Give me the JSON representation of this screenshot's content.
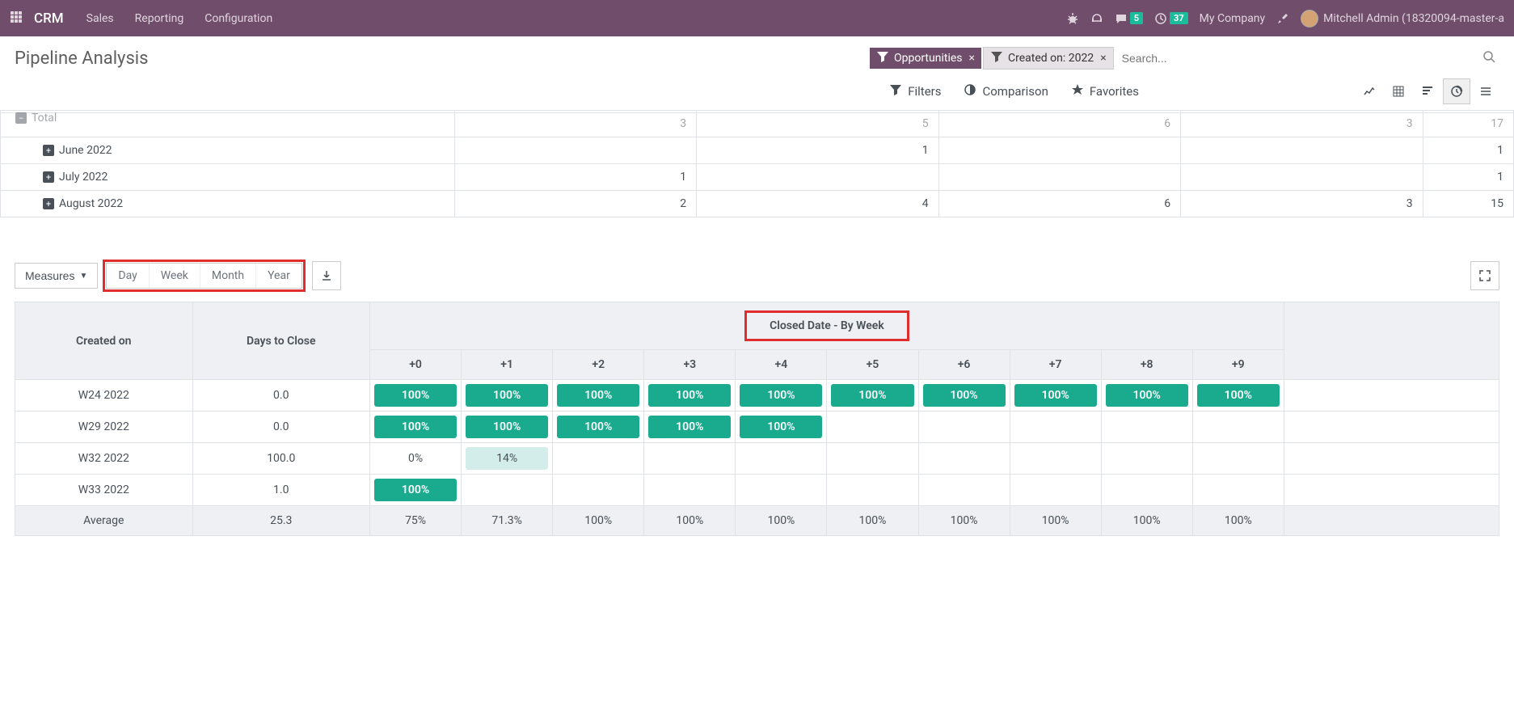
{
  "navbar": {
    "brand": "CRM",
    "links": [
      "Sales",
      "Reporting",
      "Configuration"
    ],
    "msg_badge": "5",
    "clock_badge": "37",
    "company": "My Company",
    "user": "Mitchell Admin (18320094-master-a"
  },
  "page": {
    "title": "Pipeline Analysis",
    "filter1": "Opportunities",
    "filter2": "Created on: 2022",
    "search_placeholder": "Search..."
  },
  "toolbar": {
    "filters": "Filters",
    "comparison": "Comparison",
    "favorites": "Favorites"
  },
  "pivot": {
    "rows": [
      {
        "label": "Total",
        "minus": true,
        "cells": [
          "3",
          "5",
          "6",
          "3",
          "17"
        ]
      },
      {
        "label": "June 2022",
        "minus": false,
        "cells": [
          "",
          "1",
          "",
          "",
          "1"
        ]
      },
      {
        "label": "July 2022",
        "minus": false,
        "cells": [
          "1",
          "",
          "",
          "",
          "1"
        ]
      },
      {
        "label": "August 2022",
        "minus": false,
        "cells": [
          "2",
          "4",
          "6",
          "3",
          "15"
        ]
      }
    ]
  },
  "cohort_controls": {
    "measures": "Measures",
    "segs": [
      "Day",
      "Week",
      "Month",
      "Year"
    ]
  },
  "cohort": {
    "header1": "Created on",
    "header2": "Days to Close",
    "super_header": "Closed Date - By Week",
    "cols": [
      "+0",
      "+1",
      "+2",
      "+3",
      "+4",
      "+5",
      "+6",
      "+7",
      "+8",
      "+9"
    ],
    "rows": [
      {
        "label": "W24 2022",
        "days": "0.0",
        "pct": [
          "100%",
          "100%",
          "100%",
          "100%",
          "100%",
          "100%",
          "100%",
          "100%",
          "100%",
          "100%"
        ]
      },
      {
        "label": "W29 2022",
        "days": "0.0",
        "pct": [
          "100%",
          "100%",
          "100%",
          "100%",
          "100%",
          "",
          "",
          "",
          "",
          ""
        ]
      },
      {
        "label": "W32 2022",
        "days": "100.0",
        "pct": [
          "0%",
          "14%",
          "",
          "",
          "",
          "",
          "",
          "",
          "",
          ""
        ]
      },
      {
        "label": "W33 2022",
        "days": "1.0",
        "pct": [
          "100%",
          "",
          "",
          "",
          "",
          "",
          "",
          "",
          "",
          ""
        ]
      }
    ],
    "footer": {
      "label": "Average",
      "days": "25.3",
      "pct": [
        "75%",
        "71.3%",
        "100%",
        "100%",
        "100%",
        "100%",
        "100%",
        "100%",
        "100%",
        "100%"
      ]
    }
  }
}
